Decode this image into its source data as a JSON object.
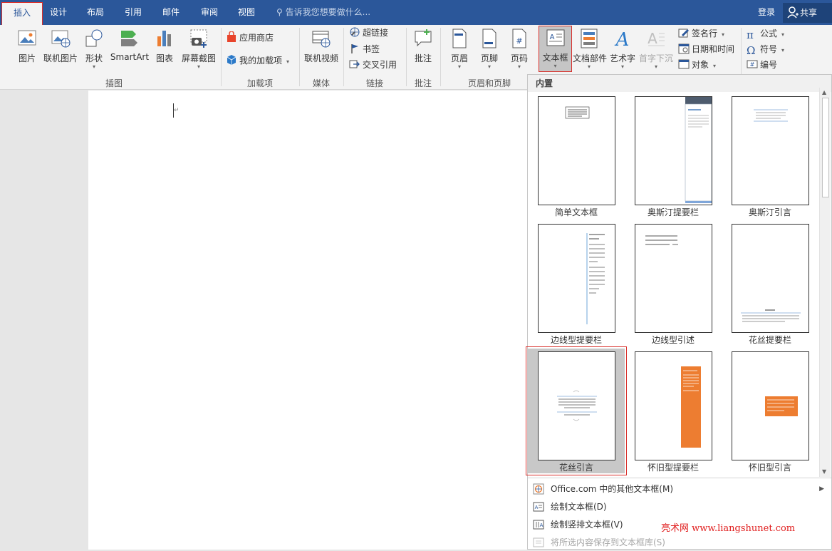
{
  "tabs": [
    {
      "label": "插入",
      "active": true
    },
    {
      "label": "设计"
    },
    {
      "label": "布局"
    },
    {
      "label": "引用"
    },
    {
      "label": "邮件"
    },
    {
      "label": "审阅"
    },
    {
      "label": "视图"
    }
  ],
  "tell_me": "告诉我您想要做什么...",
  "login": "登录",
  "share": "共享",
  "ribbon": {
    "groups": {
      "illustrations": "插图",
      "addins": "加载项",
      "media": "媒体",
      "links": "链接",
      "comments": "批注",
      "header_footer": "页眉和页脚"
    },
    "buttons": {
      "picture": "图片",
      "online_picture": "联机图片",
      "shapes": "形状",
      "smartart": "SmartArt",
      "chart": "图表",
      "screenshot": "屏幕截图",
      "app_store": "应用商店",
      "my_addins": "我的加载项",
      "online_video": "联机视频",
      "hyperlink": "超链接",
      "bookmark": "书签",
      "cross_ref": "交叉引用",
      "comment": "批注",
      "header": "页眉",
      "footer": "页脚",
      "page_number": "页码",
      "textbox": "文本框",
      "quick_parts": "文档部件",
      "wordart": "艺术字",
      "dropcap": "首字下沉",
      "signature_line": "签名行",
      "date_time": "日期和时间",
      "object": "对象",
      "equation": "公式",
      "symbol": "符号",
      "number": "编号"
    }
  },
  "gallery": {
    "header": "内置",
    "tiles": [
      {
        "label": "简单文本框"
      },
      {
        "label": "奥斯汀提要栏"
      },
      {
        "label": "奥斯汀引言"
      },
      {
        "label": "边线型提要栏"
      },
      {
        "label": "边线型引述"
      },
      {
        "label": "花丝提要栏"
      },
      {
        "label": "花丝引言",
        "selected": true
      },
      {
        "label": "怀旧型提要栏"
      },
      {
        "label": "怀旧型引言"
      }
    ],
    "footer": [
      {
        "label": "Office.com 中的其他文本框(M)",
        "has_submenu": true
      },
      {
        "label": "绘制文本框(D)"
      },
      {
        "label": "绘制竖排文本框(V)"
      },
      {
        "label": "将所选内容保存到文本框库(S)",
        "disabled": true
      }
    ]
  },
  "watermark": "亮术网 www.liangshunet.com",
  "colors": {
    "title_bar": "#2b579a",
    "highlight_red": "#d9302c",
    "orange": "#ed7d31",
    "blue_accent": "#4a7ebb"
  }
}
